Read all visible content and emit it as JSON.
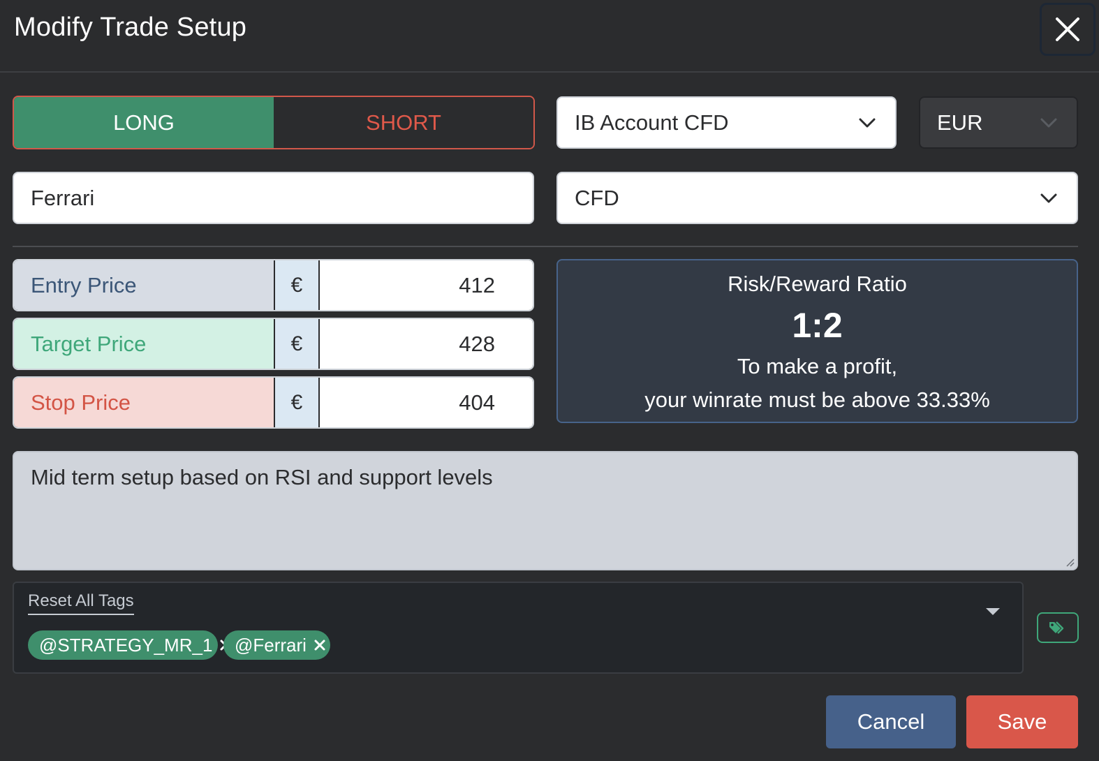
{
  "header": {
    "title": "Modify Trade Setup"
  },
  "direction": {
    "long_label": "LONG",
    "short_label": "SHORT",
    "selected": "LONG"
  },
  "account": {
    "value": "IB Account CFD"
  },
  "currency": {
    "value": "EUR"
  },
  "symbol": {
    "value": "Ferrari"
  },
  "instrument_type": {
    "value": "CFD"
  },
  "prices": {
    "entry": {
      "label": "Entry Price",
      "currency": "€",
      "value": "412"
    },
    "target": {
      "label": "Target Price",
      "currency": "€",
      "value": "428"
    },
    "stop": {
      "label": "Stop Price",
      "currency": "€",
      "value": "404"
    }
  },
  "risk_reward": {
    "title": "Risk/Reward Ratio",
    "value": "1:2",
    "line1": "To make a profit,",
    "line2": "your winrate must be above 33.33%"
  },
  "notes": {
    "value": "Mid term setup based on RSI and support levels"
  },
  "tags": {
    "reset_label": "Reset All Tags",
    "items": [
      {
        "label": "@STRATEGY_MR_1"
      },
      {
        "label": "@Ferrari"
      }
    ]
  },
  "footer": {
    "cancel_label": "Cancel",
    "save_label": "Save"
  },
  "colors": {
    "background": "#2b2c2e",
    "long_green": "#3f8f6c",
    "short_red": "#e0594a",
    "cancel_blue": "#46618a",
    "save_red": "#d9574a"
  },
  "icons": {
    "close": "close-icon",
    "dropdown": "chevron-down-icon",
    "tags": "tag-icon",
    "remove": "close-icon"
  }
}
